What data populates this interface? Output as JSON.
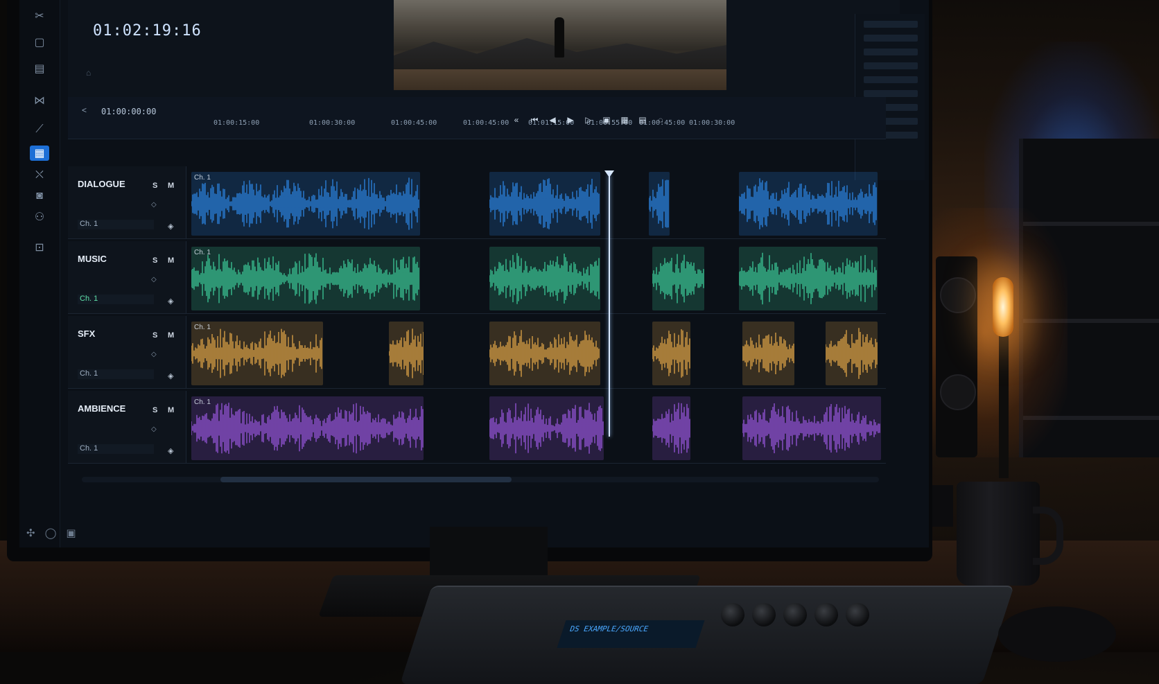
{
  "viewer": {
    "timecode": "01:02:19:16"
  },
  "ruler": {
    "start": "01:00:00:00",
    "ticks": [
      "01:00:15:00",
      "01:00:30:00",
      "01:00:45:00",
      "01:00:45:00",
      "01:01:15:00",
      "01:00:55:00",
      "01:00:45:00",
      "01:00:30:00"
    ]
  },
  "tracks": [
    {
      "name": "DIALOGUE",
      "solo": "S",
      "mute": "M",
      "channel": "Ch. 1",
      "color": "#2f8cf0",
      "clips": [
        {
          "label": "Ch. 1",
          "start": 0,
          "end": 0.33
        },
        {
          "label": "",
          "start": 0.43,
          "end": 0.59
        },
        {
          "label": "",
          "start": 0.66,
          "end": 0.69
        },
        {
          "label": "",
          "start": 0.79,
          "end": 0.99
        }
      ]
    },
    {
      "name": "MUSIC",
      "solo": "S",
      "mute": "M",
      "channel": "Ch. 1",
      "color": "#3fd6a0",
      "clips": [
        {
          "label": "Ch. 1",
          "start": 0,
          "end": 0.33
        },
        {
          "label": "",
          "start": 0.43,
          "end": 0.59
        },
        {
          "label": "",
          "start": 0.665,
          "end": 0.74
        },
        {
          "label": "",
          "start": 0.79,
          "end": 0.99
        }
      ]
    },
    {
      "name": "SFX",
      "solo": "S",
      "mute": "M",
      "channel": "Ch. 1",
      "color": "#f0b04a",
      "clips": [
        {
          "label": "Ch. 1",
          "start": 0,
          "end": 0.19
        },
        {
          "label": "",
          "start": 0.285,
          "end": 0.335
        },
        {
          "label": "",
          "start": 0.43,
          "end": 0.59
        },
        {
          "label": "",
          "start": 0.665,
          "end": 0.72
        },
        {
          "label": "",
          "start": 0.795,
          "end": 0.87
        },
        {
          "label": "",
          "start": 0.915,
          "end": 0.99
        }
      ]
    },
    {
      "name": "AMBIENCE",
      "solo": "S",
      "mute": "M",
      "channel": "Ch. 1",
      "color": "#a05ae8",
      "clips": [
        {
          "label": "Ch. 1",
          "start": 0,
          "end": 0.335
        },
        {
          "label": "",
          "start": 0.43,
          "end": 0.595
        },
        {
          "label": "",
          "start": 0.665,
          "end": 0.72
        },
        {
          "label": "",
          "start": 0.795,
          "end": 0.995
        }
      ]
    }
  ],
  "controller": {
    "display": "DS EXAMPLE/SOURCE"
  },
  "playhead": {
    "position": 0.595
  }
}
